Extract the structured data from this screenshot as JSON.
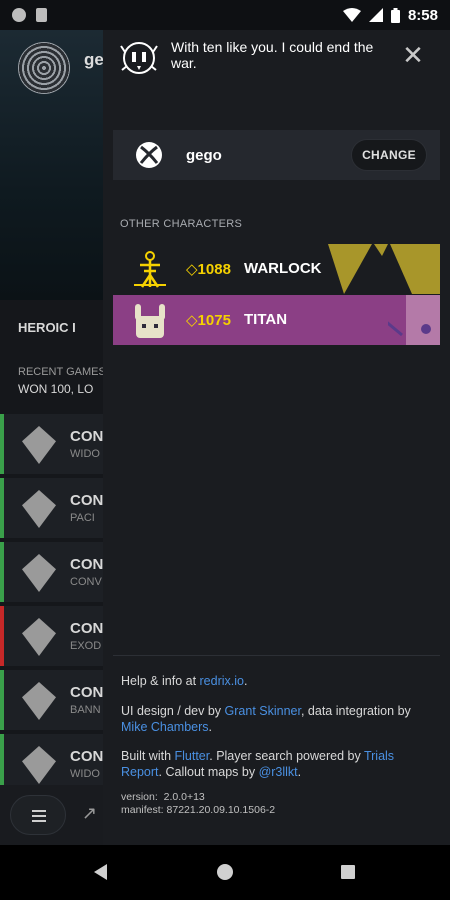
{
  "status_bar": {
    "time": "8:58"
  },
  "background": {
    "profile_name": "ge",
    "rank": "HEROIC I",
    "recent_label": "RECENT GAMES",
    "recent_summary": "WON 100, LO",
    "games": [
      {
        "title": "CON",
        "subtitle": "WIDO",
        "result_color": "#3aa04a"
      },
      {
        "title": "CON",
        "subtitle": "PACI",
        "result_color": "#3aa04a"
      },
      {
        "title": "CON",
        "subtitle": "CONV",
        "result_color": "#3aa04a"
      },
      {
        "title": "CON",
        "subtitle": "EXOD",
        "result_color": "#c62828"
      },
      {
        "title": "CON",
        "subtitle": "BANN",
        "result_color": "#3aa04a"
      },
      {
        "title": "CON",
        "subtitle": "WIDO",
        "result_color": "#3aa04a"
      }
    ]
  },
  "drawer": {
    "quote": "With ten like you. I could end the war.",
    "account": {
      "name": "gego",
      "change_label": "CHANGE"
    },
    "other_characters_label": "OTHER CHARACTERS",
    "characters": [
      {
        "power": "◇1088",
        "class": "WARLOCK"
      },
      {
        "power": "◇1075",
        "class": "TITAN"
      }
    ],
    "info": {
      "help_prefix": "Help & info at ",
      "help_link": "redrix.io",
      "help_suffix": ".",
      "design_prefix": "UI design / dev by ",
      "designer": "Grant Skinner",
      "design_mid": ", data integration by ",
      "integrator": "Mike Chambers",
      "design_suffix": ".",
      "built_prefix": "Built with ",
      "flutter": "Flutter",
      "built_mid": ". Player search powered by ",
      "trials": "Trials Report",
      "built_mid2": ". Callout maps by ",
      "maps_author": "@r3llkt",
      "built_suffix": ".",
      "version_line": "version:  2.0.0+13",
      "manifest_line": "manifest: 87221.20.09.10.1506-2"
    }
  },
  "colors": {
    "power_gold": "#f5d100",
    "link_blue": "#4a90e2",
    "titan_emblem": "#8b3f85",
    "warlock_emblem": "#a8962a"
  }
}
